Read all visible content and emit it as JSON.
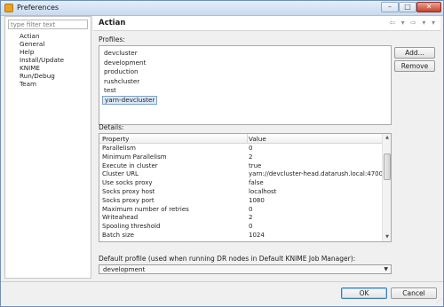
{
  "window": {
    "title": "Preferences",
    "minimize": "–",
    "maximize": "□",
    "close": "✕"
  },
  "left": {
    "filter_placeholder": "type filter text",
    "tree": [
      "Actian",
      "General",
      "Help",
      "Install/Update",
      "KNIME",
      "Run/Debug",
      "Team"
    ]
  },
  "page": {
    "title": "Actian",
    "nav_arrows": "⇦ ▾ ⇨ ▾ ▾",
    "profiles_label": "Profiles:",
    "profiles": [
      "devcluster",
      "development",
      "production",
      "rushcluster",
      "test",
      "yarn-devcluster"
    ],
    "selected_profile_index": 5,
    "add_label": "Add...",
    "remove_label": "Remove",
    "details_label": "Details:",
    "details_header": {
      "property": "Property",
      "value": "Value"
    },
    "details": [
      {
        "property": "Parallelism",
        "value": "0"
      },
      {
        "property": "Minimum Parallelism",
        "value": "2"
      },
      {
        "property": "Execute in cluster",
        "value": "true"
      },
      {
        "property": "Cluster URL",
        "value": "yarn://devcluster-head.datarush.local:47000"
      },
      {
        "property": "Use socks proxy",
        "value": "false"
      },
      {
        "property": "Socks proxy host",
        "value": "localhost"
      },
      {
        "property": "Socks proxy port",
        "value": "1080"
      },
      {
        "property": "Maximum number of retries",
        "value": "0"
      },
      {
        "property": "Writeahead",
        "value": "2"
      },
      {
        "property": "Spooling threshold",
        "value": "0"
      },
      {
        "property": "Batch size",
        "value": "1024"
      }
    ],
    "default_profile_label": "Default profile (used when running DR nodes in Default KNIME Job Manager):",
    "default_profile_value": "development"
  },
  "footer": {
    "ok_label": "OK",
    "cancel_label": "Cancel"
  }
}
